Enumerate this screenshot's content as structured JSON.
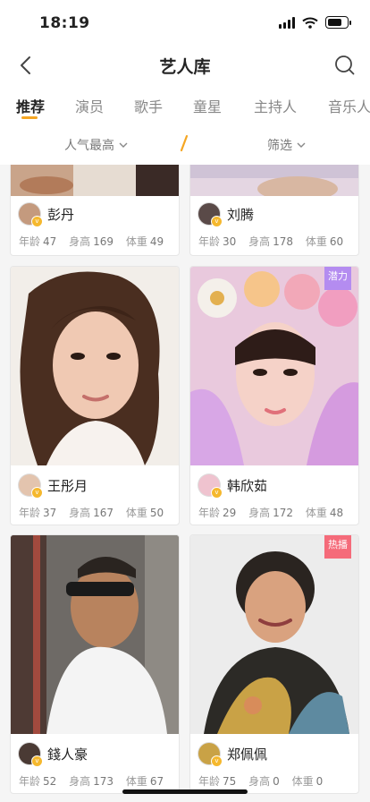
{
  "status": {
    "time": "18:19"
  },
  "nav": {
    "title": "艺人库"
  },
  "tabs": [
    {
      "label": "推荐",
      "active": true
    },
    {
      "label": "演员"
    },
    {
      "label": "歌手"
    },
    {
      "label": "童星"
    },
    {
      "label": "主持人"
    },
    {
      "label": "音乐人"
    }
  ],
  "filters": {
    "sort": "人气最高",
    "filter": "筛选"
  },
  "labels": {
    "age": "年龄",
    "height": "身高",
    "weight": "体重"
  },
  "artists": [
    {
      "name": "彭丹",
      "age": "47",
      "height": "169",
      "weight": "49"
    },
    {
      "name": "刘腾",
      "age": "30",
      "height": "178",
      "weight": "60"
    },
    {
      "name": "王彤月",
      "age": "37",
      "height": "167",
      "weight": "50"
    },
    {
      "name": "韩欣茹",
      "age": "29",
      "height": "172",
      "weight": "48",
      "tag": "潜力"
    },
    {
      "name": "錢人豪",
      "age": "52",
      "height": "173",
      "weight": "67"
    },
    {
      "name": "郑佩佩",
      "age": "75",
      "height": "0",
      "weight": "0",
      "tag": "热播"
    }
  ],
  "colors": {
    "accent": "#f5a623",
    "potential_tag": "#b48cf0",
    "hot_tag": "#f56b7a"
  }
}
